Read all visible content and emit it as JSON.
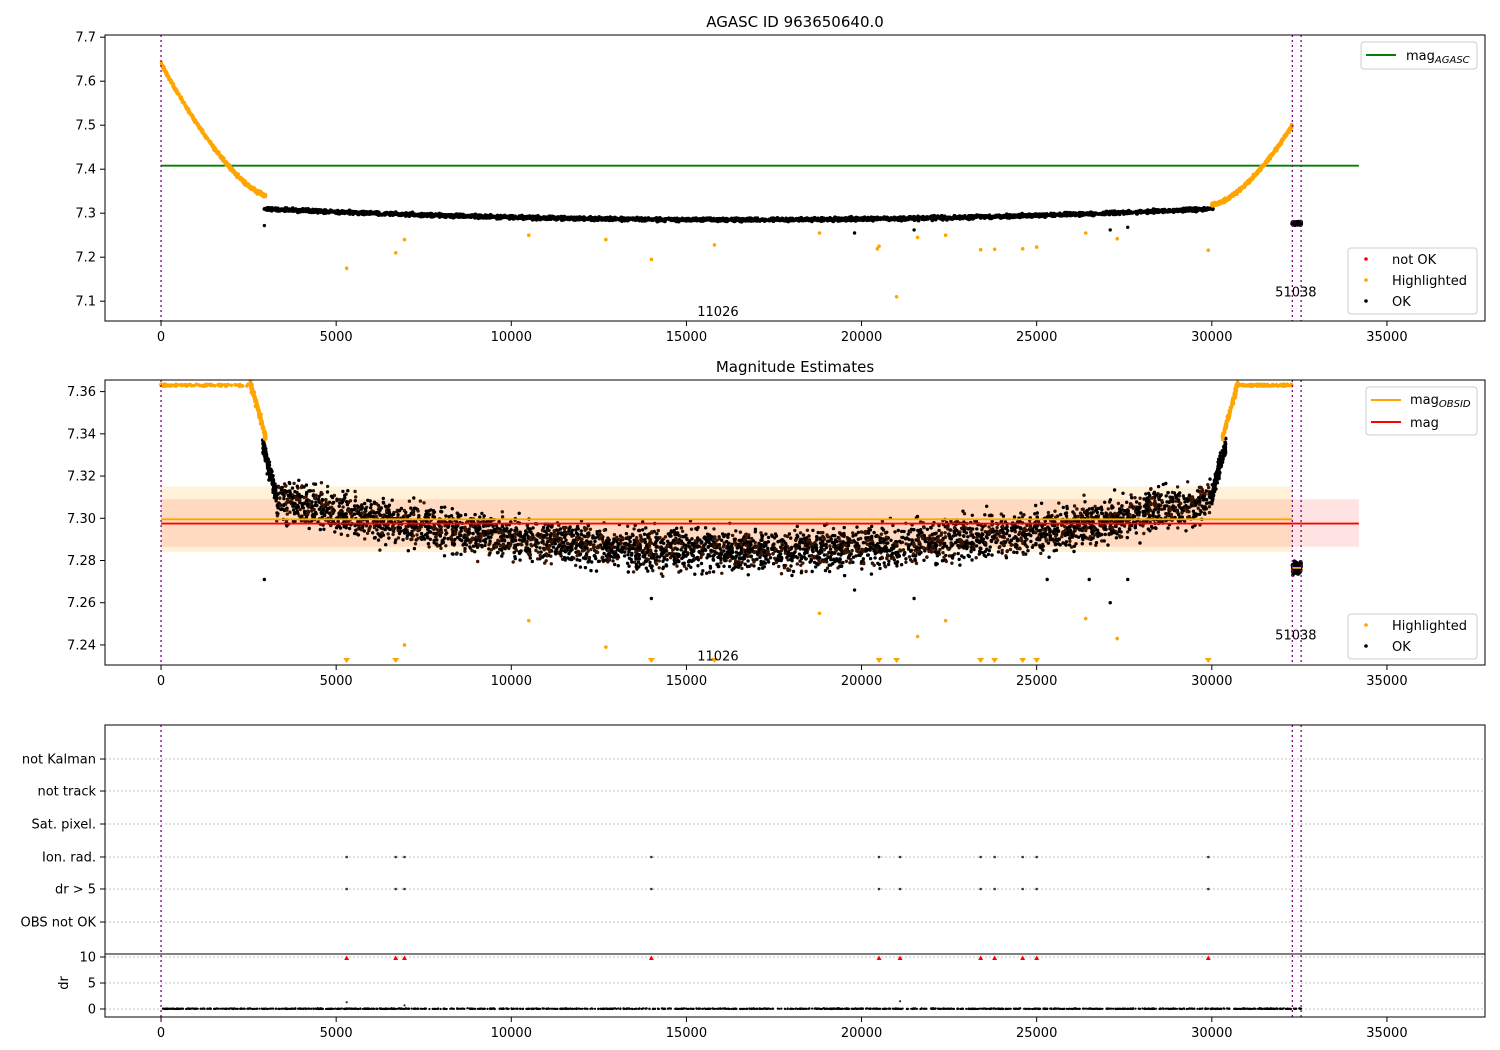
{
  "chart_data": [
    {
      "type": "scatter",
      "title": "AGASC ID 963650640.0",
      "xlim": [
        -1600,
        37800
      ],
      "ylim": [
        7.055,
        7.705
      ],
      "xticks": [
        0,
        5000,
        10000,
        15000,
        20000,
        25000,
        30000,
        35000
      ],
      "yticks": [
        7.1,
        7.2,
        7.3,
        7.4,
        7.5,
        7.6,
        7.7
      ],
      "ytick_labels": [
        "7.1",
        "7.2",
        "7.3",
        "7.4",
        "7.5",
        "7.6",
        "7.7"
      ],
      "obsid_boundaries": [
        0,
        32300,
        32550
      ],
      "obsid_labels": [
        {
          "text": "11026",
          "x": 15900,
          "y": 7.075
        },
        {
          "text": "51038",
          "x": 32400,
          "y": 7.12
        }
      ],
      "reference_lines": [
        {
          "name": "mag_AGASC",
          "value": 7.408,
          "x_start": 0,
          "x_end": 34200,
          "color": "#008000"
        }
      ],
      "legend": {
        "top_right": [
          {
            "label": "mag",
            "sub": "AGASC",
            "kind": "line",
            "color": "#008000"
          }
        ],
        "bottom_right": [
          {
            "label": "not OK",
            "color": "#ff0000"
          },
          {
            "label": "Highlighted",
            "color": "#ffa500"
          },
          {
            "label": "OK",
            "color": "#000000"
          }
        ]
      },
      "highlight_trend": {
        "color": "#ffa500",
        "segments": [
          {
            "x0": 0,
            "x1": 3000,
            "y0": 7.64,
            "y1": 7.34,
            "shape": "convex"
          },
          {
            "x0": 30000,
            "x1": 32300,
            "y0": 7.32,
            "y1": 7.5,
            "shape": "concave"
          }
        ]
      },
      "ok_band": {
        "x_start": 2950,
        "x_end": 30050,
        "y_at_ends": 7.31,
        "y_min": 7.285,
        "spread": 0.008,
        "color": "#000000"
      },
      "second_obsid": {
        "x": [
          32300,
          32550
        ],
        "y": 7.277,
        "spread": 0.006
      },
      "highlighted_outliers": [
        [
          5300,
          7.175
        ],
        [
          6700,
          7.21
        ],
        [
          6950,
          7.24
        ],
        [
          10500,
          7.25
        ],
        [
          12700,
          7.24
        ],
        [
          14000,
          7.195
        ],
        [
          15800,
          7.228
        ],
        [
          18800,
          7.255
        ],
        [
          20500,
          7.225
        ],
        [
          20450,
          7.219
        ],
        [
          21000,
          7.11
        ],
        [
          21600,
          7.245
        ],
        [
          22400,
          7.25
        ],
        [
          23400,
          7.217
        ],
        [
          23800,
          7.218
        ],
        [
          24600,
          7.219
        ],
        [
          25000,
          7.223
        ],
        [
          26400,
          7.255
        ],
        [
          27300,
          7.242
        ],
        [
          29900,
          7.216
        ]
      ],
      "ok_outliers": [
        [
          2950,
          7.272
        ],
        [
          19800,
          7.255
        ],
        [
          21500,
          7.262
        ],
        [
          27100,
          7.262
        ],
        [
          27600,
          7.268
        ]
      ]
    },
    {
      "type": "scatter",
      "title": "Magnitude Estimates",
      "xlim": [
        -1600,
        37800
      ],
      "ylim": [
        7.2305,
        7.3655
      ],
      "xticks": [
        0,
        5000,
        10000,
        15000,
        20000,
        25000,
        30000,
        35000
      ],
      "yticks": [
        7.24,
        7.26,
        7.28,
        7.3,
        7.32,
        7.34,
        7.36
      ],
      "ytick_labels": [
        "7.24",
        "7.26",
        "7.28",
        "7.30",
        "7.32",
        "7.34",
        "7.36"
      ],
      "obsid_boundaries": [
        0,
        32300,
        32550
      ],
      "obsid_labels": [
        {
          "text": "11026",
          "x": 15900,
          "y": 7.2345
        },
        {
          "text": "51038",
          "x": 32400,
          "y": 7.2445
        }
      ],
      "bands": [
        {
          "x_start": 0,
          "x_end": 34200,
          "y0": 7.2865,
          "y1": 7.309,
          "color": "#ff0000",
          "opacity": 0.11
        },
        {
          "x_start": 0,
          "x_end": 32300,
          "y0": 7.284,
          "y1": 7.315,
          "color": "#ffa500",
          "opacity": 0.15
        }
      ],
      "reference_lines": [
        {
          "name": "mag_OBSID",
          "value": 7.2995,
          "x_start": 0,
          "x_end": 32300,
          "color": "#ffa500"
        },
        {
          "name": "mag_OBSID_2",
          "value": 7.2765,
          "x_start": 32300,
          "x_end": 32550,
          "color": "#ffa500"
        },
        {
          "name": "mag",
          "value": 7.2975,
          "x_start": 0,
          "x_end": 34200,
          "color": "#ff0000"
        }
      ],
      "legend": {
        "top_right": [
          {
            "label": "mag",
            "sub": "OBSID",
            "kind": "line",
            "color": "#ffa500"
          },
          {
            "label": "mag",
            "sub": "",
            "kind": "line",
            "color": "#ff0000"
          }
        ],
        "bottom_right": [
          {
            "label": "Highlighted",
            "color": "#ffa500"
          },
          {
            "label": "OK",
            "color": "#000000"
          }
        ]
      },
      "clipped_top": {
        "y": 7.3635,
        "segments": [
          [
            0,
            2600
          ],
          [
            30700,
            32300
          ]
        ]
      },
      "clipped_bottom_markers": [
        5300,
        6700,
        14000,
        15800,
        20500,
        21000,
        23400,
        23800,
        24600,
        25000,
        29900
      ],
      "highlighted_outliers": [
        [
          6950,
          7.24
        ],
        [
          10500,
          7.2515
        ],
        [
          12700,
          7.239
        ],
        [
          18800,
          7.255
        ],
        [
          21600,
          7.244
        ],
        [
          22400,
          7.2515
        ],
        [
          26400,
          7.2525
        ],
        [
          27300,
          7.243
        ]
      ],
      "ok_outliers": [
        [
          2950,
          7.271
        ],
        [
          14000,
          7.262
        ],
        [
          19800,
          7.266
        ],
        [
          21500,
          7.262
        ],
        [
          25300,
          7.271
        ],
        [
          26500,
          7.271
        ],
        [
          27100,
          7.26
        ],
        [
          27600,
          7.271
        ]
      ]
    },
    {
      "type": "scatter",
      "title": "",
      "xlim": [
        -1600,
        37800
      ],
      "xticks": [
        0,
        5000,
        10000,
        15000,
        20000,
        25000,
        30000,
        35000
      ],
      "obsid_boundaries": [
        0,
        32300,
        32550
      ],
      "flag_rows": [
        "not Kalman",
        "not track",
        "Sat. pixel.",
        "Ion. rad.",
        "dr > 5",
        "OBS not OK"
      ],
      "flag_points": {
        "Ion. rad.": [
          5300,
          6700,
          6950,
          14000,
          20500,
          21100,
          23400,
          23800,
          24600,
          25000,
          29900
        ],
        "dr > 5": [
          5300,
          6700,
          6950,
          14000,
          20500,
          21100,
          23400,
          23800,
          24600,
          25000,
          29900
        ]
      },
      "dr_panel": {
        "ylabel": "dr",
        "ylim": [
          -0.5,
          10.5
        ],
        "yticks": [
          0,
          5,
          10
        ],
        "ytick_labels": [
          "0",
          "5",
          "10"
        ],
        "clipped_markers": [
          5300,
          6700,
          6950,
          14000,
          20500,
          21100,
          23400,
          23800,
          24600,
          25000,
          29900
        ],
        "extra_points": [
          [
            5300,
            1.3
          ],
          [
            21100,
            1.5
          ],
          [
            6950,
            0.7
          ]
        ]
      }
    }
  ],
  "x_tick_labels": [
    "0",
    "5000",
    "10000",
    "15000",
    "20000",
    "25000",
    "30000",
    "35000"
  ]
}
